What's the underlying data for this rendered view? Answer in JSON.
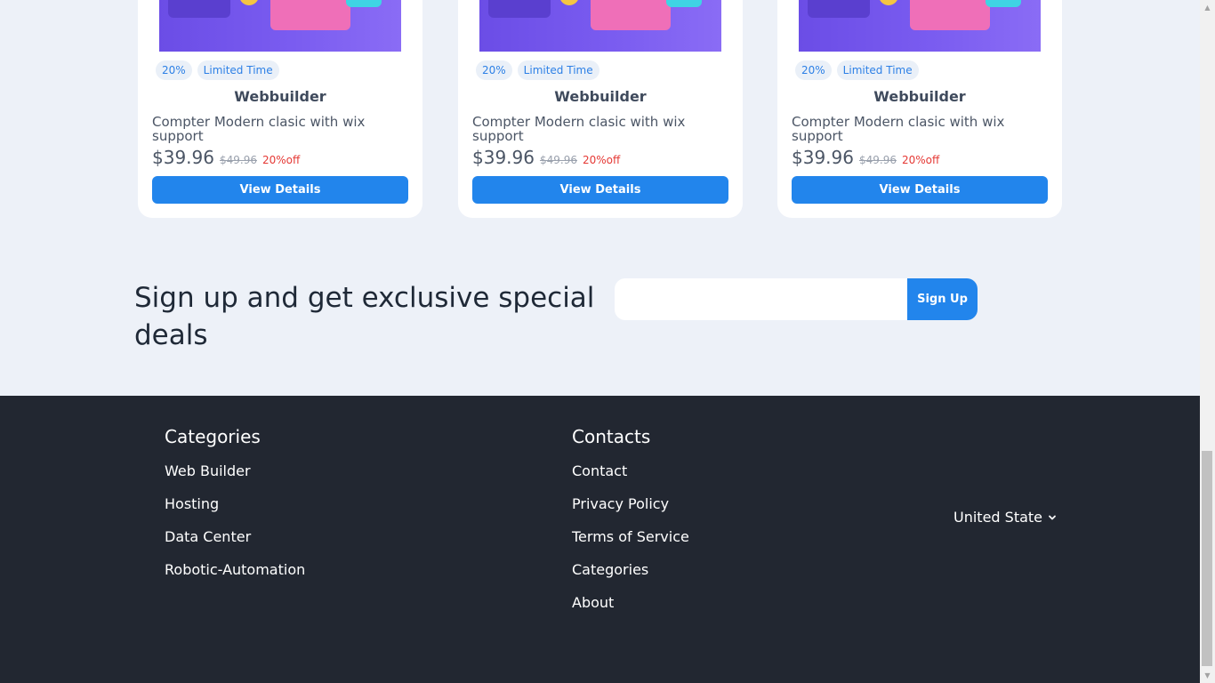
{
  "products": [
    {
      "badges": [
        "20%",
        "Limited Time"
      ],
      "title": "Webbuilder",
      "description": "Compter Modern clasic with wix support",
      "price": "$39.96",
      "old_price": "$49.96",
      "discount": "20%off",
      "button_label": "View Details"
    },
    {
      "badges": [
        "20%",
        "Limited Time"
      ],
      "title": "Webbuilder",
      "description": "Compter Modern clasic with wix support",
      "price": "$39.96",
      "old_price": "$49.96",
      "discount": "20%off",
      "button_label": "View Details"
    },
    {
      "badges": [
        "20%",
        "Limited Time"
      ],
      "title": "Webbuilder",
      "description": "Compter Modern clasic with wix support",
      "price": "$39.96",
      "old_price": "$49.96",
      "discount": "20%off",
      "button_label": "View Details"
    }
  ],
  "signup": {
    "heading": "Sign up and get exclusive special deals",
    "email_placeholder": "",
    "button_label": "Sign Up"
  },
  "footer": {
    "categories": {
      "title": "Categories",
      "links": [
        "Web Builder",
        "Hosting",
        "Data Center",
        "Robotic-Automation"
      ]
    },
    "contacts": {
      "title": "Contacts",
      "links": [
        "Contact",
        "Privacy Policy",
        "Terms of Service",
        "Categories",
        "About"
      ]
    },
    "region": {
      "label": "United State",
      "icon": "chevron-down-icon"
    }
  },
  "colors": {
    "accent": "#2285ec",
    "page_background": "#edf1f8",
    "footer_background": "#222731",
    "discount": "#e53935"
  }
}
